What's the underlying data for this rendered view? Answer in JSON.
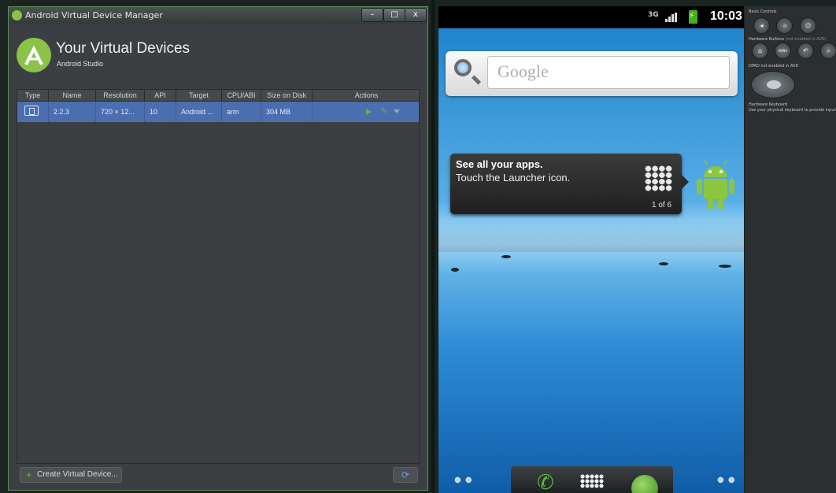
{
  "avd_window": {
    "title": "Android Virtual Device Manager",
    "buttons": {
      "minimize": "–",
      "maximize": "□",
      "close": "x"
    },
    "heading": "Your Virtual Devices",
    "subheading": "Android Studio",
    "columns": [
      "Type",
      "Name",
      "Resolution",
      "API",
      "Target",
      "CPU/ABI",
      "Size on Disk",
      "Actions"
    ],
    "rows": [
      {
        "name": "2.2.3",
        "resolution": "720 × 12...",
        "api": "10",
        "target": "Android ...",
        "cpu": "arm",
        "size": "304 MB"
      }
    ],
    "create_button": "Create Virtual Device...",
    "refresh_icon": "refresh-icon",
    "colors": {
      "selected_row": "#4b6eaf",
      "accent_green": "#62b543"
    }
  },
  "emulator": {
    "status": {
      "network": "3G",
      "time": "10:03"
    },
    "search_placeholder": "Google",
    "tip": {
      "title": "See all your apps.",
      "body": "Touch the Launcher icon.",
      "counter": "1 of 6"
    },
    "dock_icons": [
      "phone-icon",
      "app-drawer-icon",
      "browser-icon"
    ]
  },
  "control_panel": {
    "basic_controls": "Basic Controls",
    "hardware_buttons": "Hardware Buttons",
    "hardware_buttons_note": "(not enabled in AVD)",
    "dpad_note": "DPAD not enabled in AVD",
    "keyboard_title": "Hardware Keyboard",
    "keyboard_note": "Use your physical keyboard to provide input",
    "menu_label": "MENU"
  }
}
